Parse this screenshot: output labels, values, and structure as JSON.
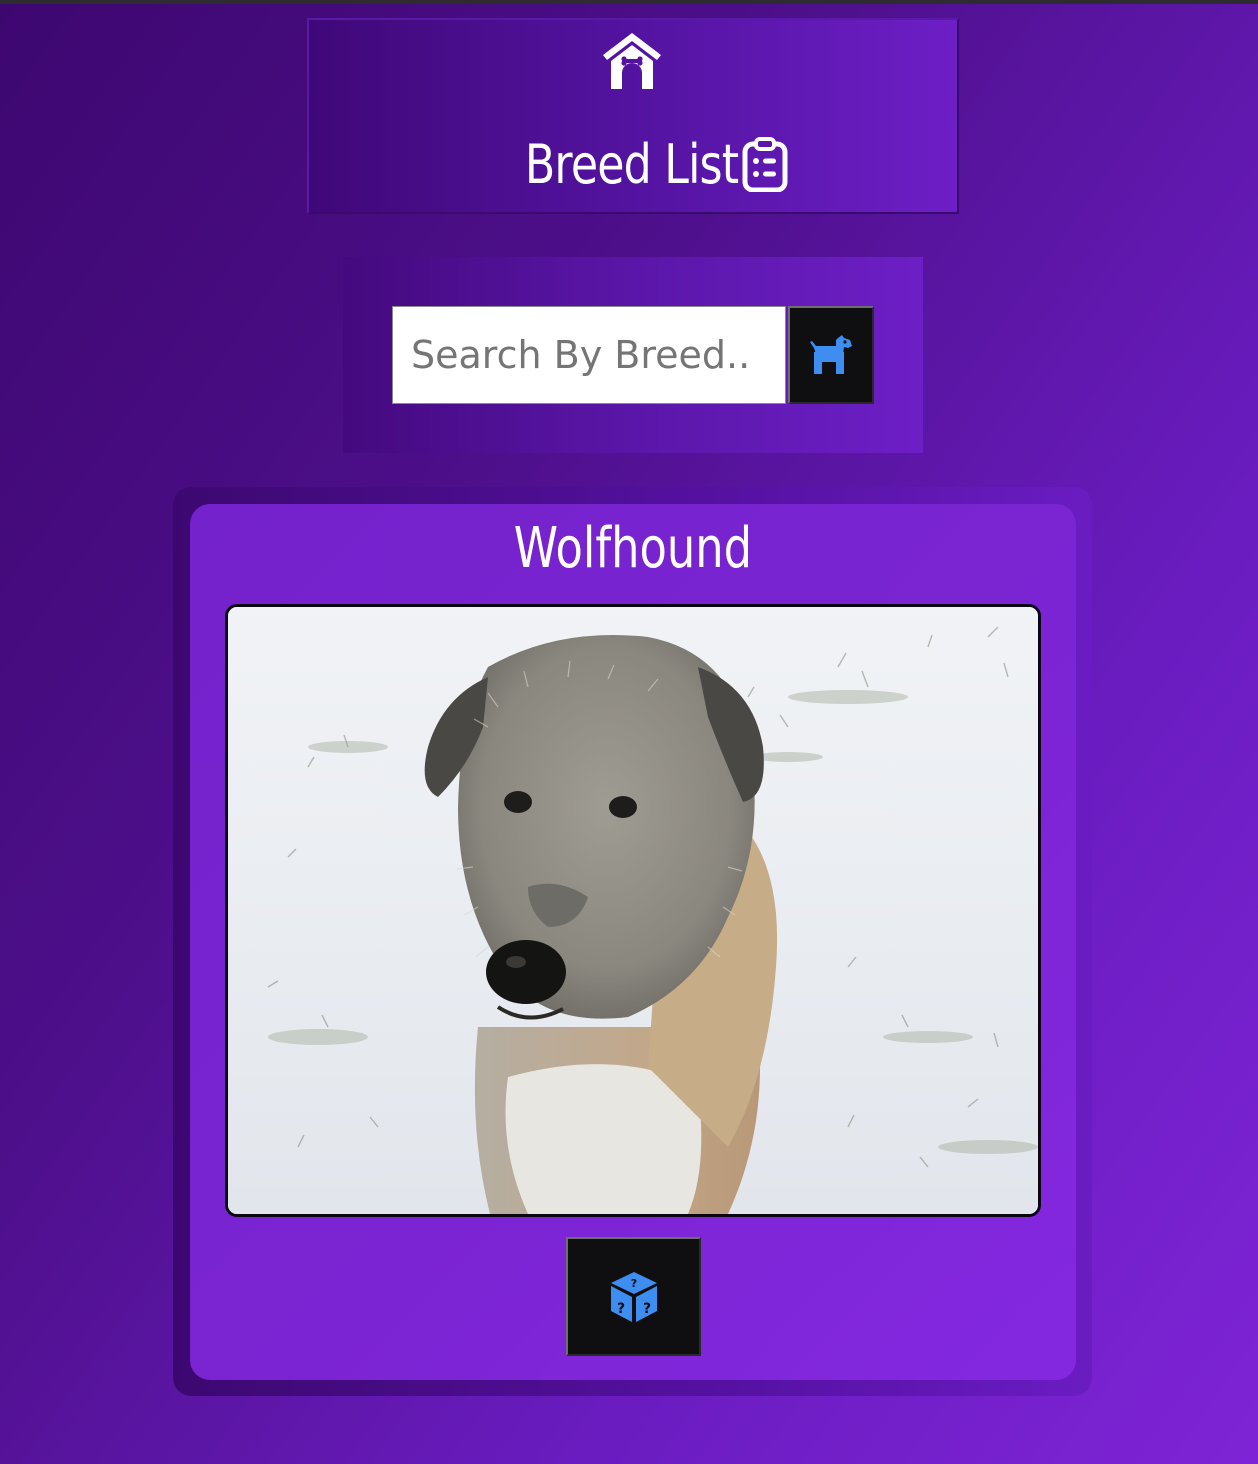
{
  "header": {
    "title": "Breed List",
    "home_icon": "dog-house-icon",
    "list_icon": "clipboard-list-icon"
  },
  "search": {
    "placeholder": "Search By Breed..",
    "value": "",
    "button_icon": "dog-icon"
  },
  "card": {
    "breed_name": "Wolfhound",
    "photo_subject": "dog in snow",
    "random_button_icon": "dice-question-icon"
  },
  "colors": {
    "accent_blue": "#3d8ef0",
    "button_bg": "#0f0f12",
    "card_purple": "#7a24d2",
    "bg_dark_purple": "#3d0770"
  }
}
